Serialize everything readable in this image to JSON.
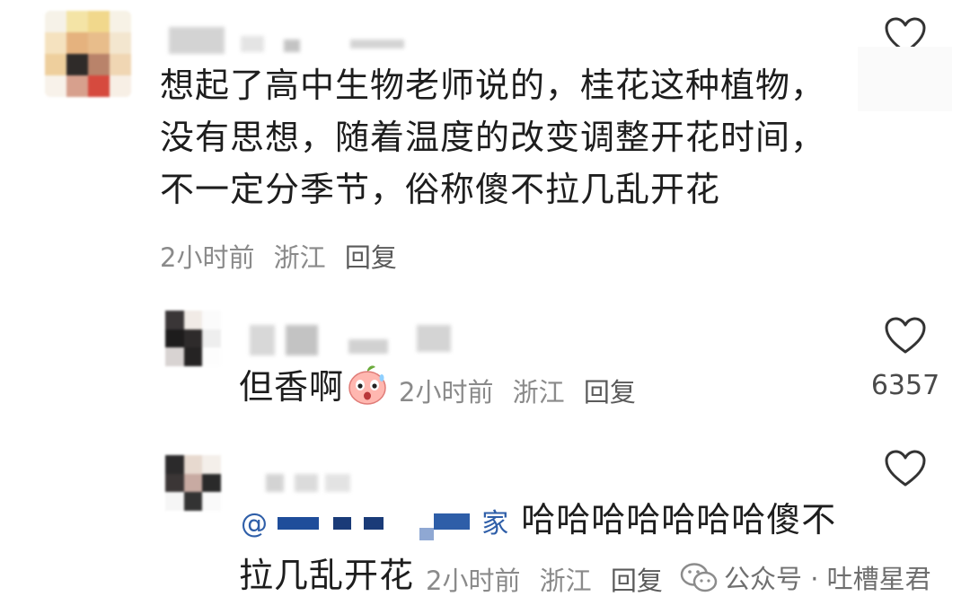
{
  "colors": {
    "text": "#1d1d1d",
    "meta": "#8a8a8a",
    "reply": "#5a5a5a",
    "mention_blue": "#2e5ea8"
  },
  "comments": [
    {
      "text_lines": [
        "想起了高中生物老师说的，桂花这种植物，",
        "没有思想，随着温度的改变调整开花时间，",
        "不一定分季节，俗称傻不拉几乱开花"
      ],
      "time": "2小时前",
      "location": "浙江",
      "reply_label": "回复",
      "like_icon": "heart-outline-icon"
    }
  ],
  "replies": [
    {
      "text": "但香啊",
      "emoji": "sweating-peach-face-emoji",
      "time": "2小时前",
      "location": "浙江",
      "reply_label": "回复",
      "like_icon": "heart-outline-icon",
      "like_count": "6357"
    },
    {
      "mention_icon": "at-mention-icon",
      "mention_tail": "家",
      "text_line1": "哈哈哈哈哈哈哈傻不",
      "text_line2": "拉几乱开花",
      "time": "2小时前",
      "location": "浙江",
      "reply_label": "回复",
      "like_icon": "heart-outline-icon"
    }
  ],
  "watermark": {
    "icon": "wechat-icon",
    "text": "公众号 · 吐槽星君"
  }
}
